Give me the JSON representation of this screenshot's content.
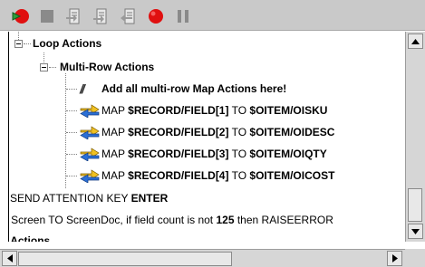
{
  "toolbar": {
    "buttons": [
      {
        "icon": "record-run-icon",
        "enabled": true
      },
      {
        "icon": "stop-icon",
        "enabled": false
      },
      {
        "icon": "step-over-icon",
        "enabled": false
      },
      {
        "icon": "step-into-icon",
        "enabled": false
      },
      {
        "icon": "step-out-icon",
        "enabled": false
      },
      {
        "icon": "record-icon",
        "enabled": true
      },
      {
        "icon": "pause-icon",
        "enabled": false
      }
    ]
  },
  "tree": {
    "loop_actions": "Loop Actions",
    "multi_row_actions": "Multi-Row Actions",
    "comment": "Add all multi-row Map Actions here!",
    "map_rows": [
      {
        "prefix": "MAP",
        "source": "$RECORD/FIELD[1]",
        "to": "TO",
        "target": "$OITEM/OISKU"
      },
      {
        "prefix": "MAP",
        "source": "$RECORD/FIELD[2]",
        "to": "TO",
        "target": "$OITEM/OIDESC"
      },
      {
        "prefix": "MAP",
        "source": "$RECORD/FIELD[3]",
        "to": "TO",
        "target": "$OITEM/OIQTY"
      },
      {
        "prefix": "MAP",
        "source": "$RECORD/FIELD[4]",
        "to": "TO",
        "target": "$OITEM/OICOST"
      }
    ],
    "send_key": {
      "prefix": "SEND ATTENTION KEY",
      "key": "ENTER"
    },
    "screen_line": {
      "prefix": "P Screen TO ScreenDoc, if field count is not",
      "count": "125",
      "suffix": "then RAISEERROR"
    },
    "actions_partial": "n Actions"
  },
  "colors": {
    "toolbar_bg": "#c9c9c9",
    "record_red": "#e01010",
    "run_green": "#2e9e3a",
    "map_blue": "#2a6fd6",
    "map_yellow": "#f0c020"
  }
}
